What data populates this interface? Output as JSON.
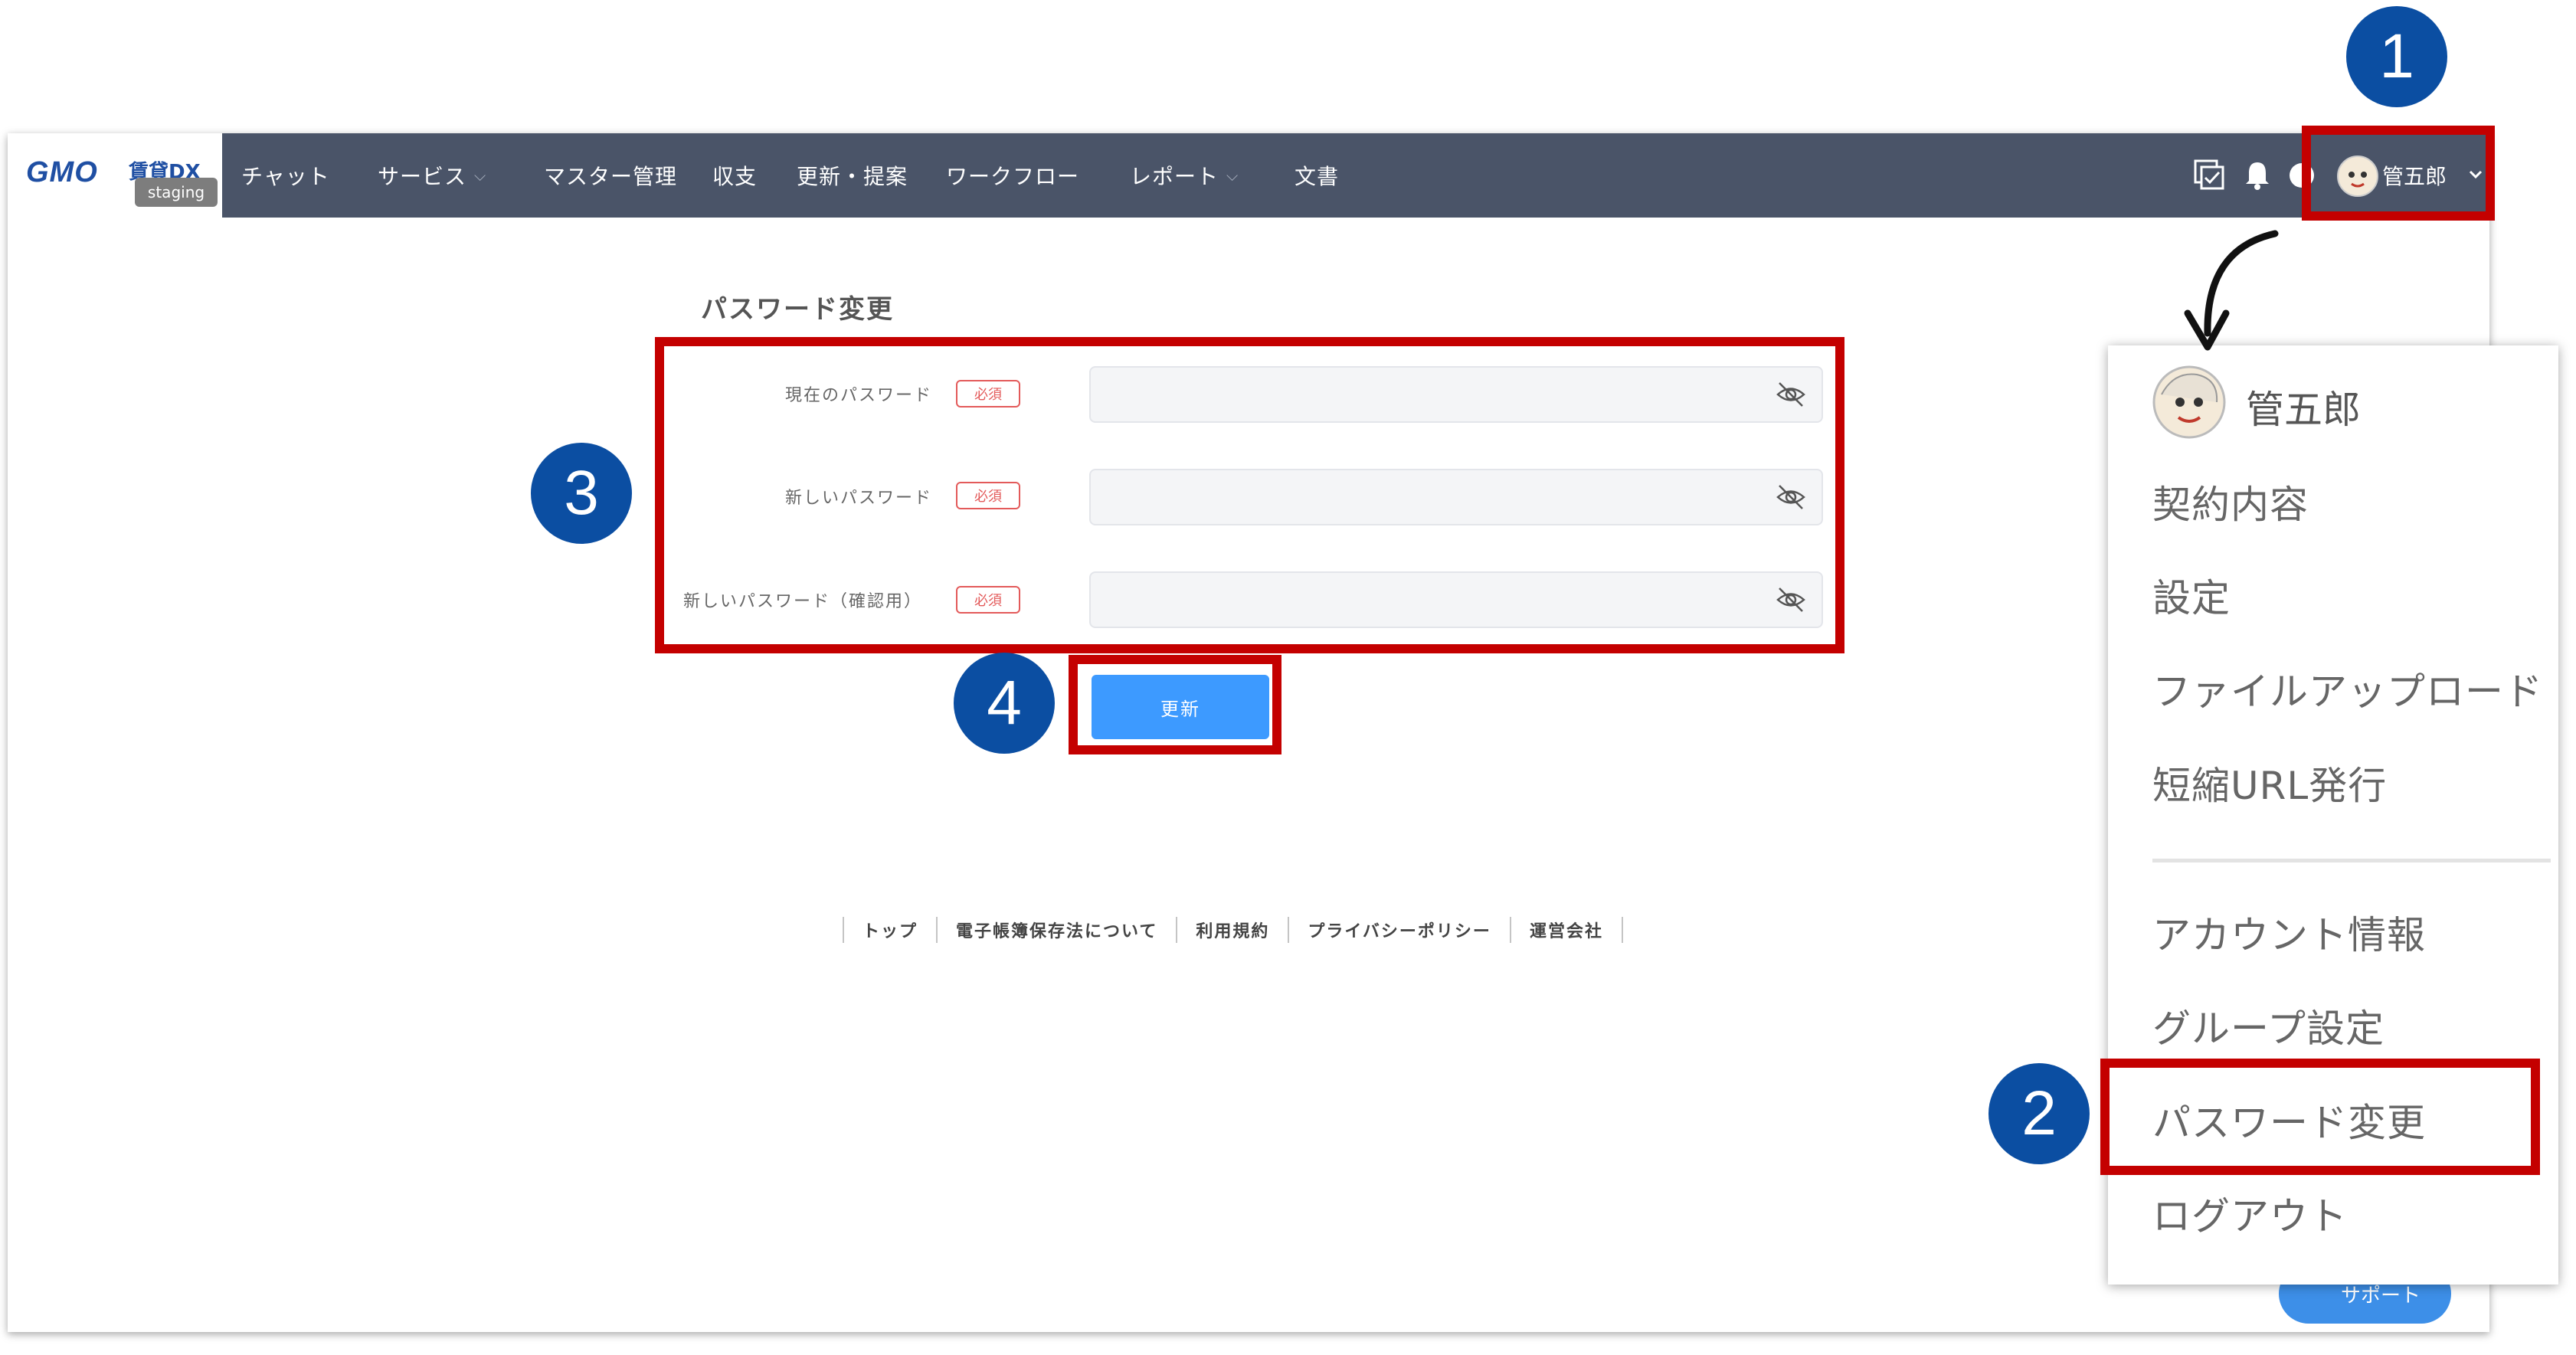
{
  "app": {
    "logo": {
      "brand": "GMO",
      "product": "賃貸DX",
      "env_badge": "staging"
    },
    "nav": [
      {
        "label": "チャット",
        "has_dropdown": false
      },
      {
        "label": "サービス",
        "has_dropdown": true
      },
      {
        "label": "マスター管理",
        "has_dropdown": false
      },
      {
        "label": "収支",
        "has_dropdown": false
      },
      {
        "label": "更新・提案",
        "has_dropdown": false
      },
      {
        "label": "ワークフロー",
        "has_dropdown": false
      },
      {
        "label": "レポート",
        "has_dropdown": true
      },
      {
        "label": "文書",
        "has_dropdown": false
      }
    ],
    "header_icons": [
      "task-check-icon",
      "bell-icon",
      "help-icon"
    ],
    "user": {
      "name": "管五郎"
    }
  },
  "password_form": {
    "title": "パスワード変更",
    "required_badge": "必須",
    "fields": [
      {
        "label": "現在のパスワード",
        "value": ""
      },
      {
        "label": "新しいパスワード",
        "value": ""
      },
      {
        "label": "新しいパスワード（確認用）",
        "value": ""
      }
    ],
    "submit_label": "更新"
  },
  "footer": {
    "links": [
      "トップ",
      "電子帳簿保存法について",
      "利用規約",
      "プライバシーポリシー",
      "運営会社"
    ]
  },
  "support_button": {
    "label": "サポート"
  },
  "user_menu": {
    "username": "管五郎",
    "items_top": [
      "契約内容",
      "設定",
      "ファイルアップロード",
      "短縮URL発行"
    ],
    "items_bottom": [
      "アカウント情報",
      "グループ設定",
      "パスワード変更",
      "ログアウト"
    ]
  },
  "annotations": {
    "steps": [
      "1",
      "2",
      "3",
      "4"
    ],
    "highlight_color": "#c40000",
    "step_color": "#0b4ea2"
  },
  "colors": {
    "navbar": "#4a5468",
    "primary_button": "#3d9aff",
    "required": "#e35a5a"
  }
}
